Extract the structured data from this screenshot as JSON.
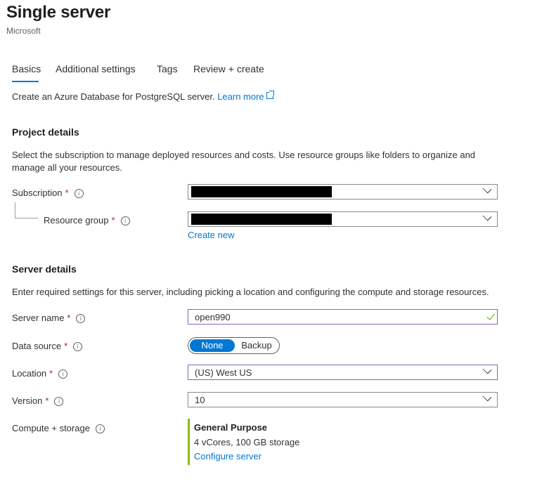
{
  "header": {
    "title": "Single server",
    "subtitle": "Microsoft"
  },
  "tabs": [
    {
      "label": "Basics",
      "active": true
    },
    {
      "label": "Additional settings"
    },
    {
      "label": "Tags"
    },
    {
      "label": "Review + create"
    }
  ],
  "intro": {
    "text": "Create an Azure Database for PostgreSQL server.",
    "link": "Learn more"
  },
  "project": {
    "heading": "Project details",
    "description": "Select the subscription to manage deployed resources and costs. Use resource groups like folders to organize and manage all your resources.",
    "subscription_label": "Subscription",
    "resource_group_label": "Resource group",
    "create_new": "Create new"
  },
  "server": {
    "heading": "Server details",
    "description": "Enter required settings for this server, including picking a location and configuring the compute and storage resources.",
    "server_name_label": "Server name",
    "server_name_value": "open990",
    "data_source_label": "Data source",
    "data_source_options": [
      "None",
      "Backup"
    ],
    "data_source_selected": "None",
    "location_label": "Location",
    "location_value": "(US) West US",
    "version_label": "Version",
    "version_value": "10",
    "compute_label": "Compute + storage",
    "compute_tier": "General Purpose",
    "compute_spec": "4 vCores, 100 GB storage",
    "configure_link": "Configure server"
  },
  "colors": {
    "accent": "#0078d4",
    "required": "#a4262c",
    "valid": "#57a300",
    "focus_border": "#8764b8",
    "compute_bar": "#8cbd18"
  }
}
